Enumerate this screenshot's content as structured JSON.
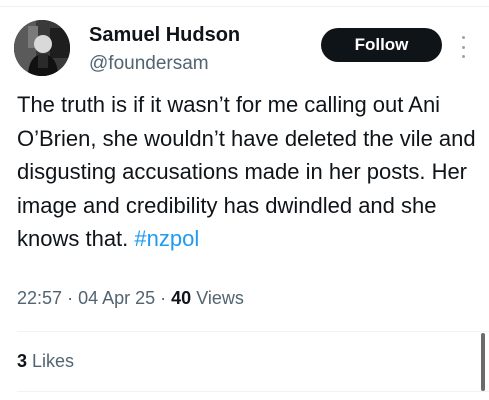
{
  "author": {
    "name": "Samuel Hudson",
    "handle": "@foundersam",
    "avatar_icon": "user-photo-icon"
  },
  "follow_label": "Follow",
  "more_icon": "more-vertical-icon",
  "tweet": {
    "text": "The truth is if it wasn’t for me calling out Ani O’Brien, she wouldn’t have deleted the vile and disgusting accusations made in her posts. Her image and credibility has dwindled and she knows that.",
    "hashtag": "#nzpol"
  },
  "meta": {
    "time": "22:57",
    "separator": "·",
    "date": "04 Apr 25",
    "views_count": "40",
    "views_label": "Views"
  },
  "likes": {
    "count": "3",
    "label": "Likes"
  },
  "colors": {
    "text": "#0f1419",
    "secondary": "#536471",
    "hashtag": "#1d9bf0",
    "follow_bg": "#0f1419",
    "follow_text": "#ffffff"
  }
}
